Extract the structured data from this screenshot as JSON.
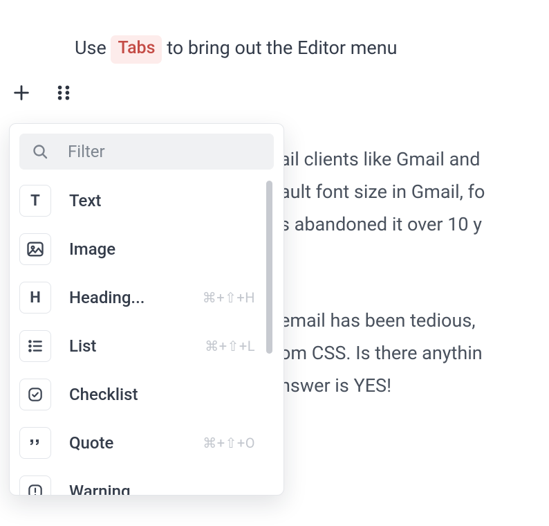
{
  "top_instruction": {
    "prefix": "Use",
    "badge": "Tabs",
    "suffix": "to bring out the Editor menu"
  },
  "popup": {
    "filter_placeholder": "Filter",
    "items": [
      {
        "icon": "T",
        "type": "letter",
        "label": "Text",
        "shortcut": ""
      },
      {
        "icon": "image",
        "type": "svg",
        "label": "Image",
        "shortcut": ""
      },
      {
        "icon": "H",
        "type": "letter",
        "label": "Heading...",
        "shortcut": "⌘+⇧+H"
      },
      {
        "icon": "list",
        "type": "svg",
        "label": "List",
        "shortcut": "⌘+⇧+L"
      },
      {
        "icon": "checklist",
        "type": "svg",
        "label": "Checklist",
        "shortcut": ""
      },
      {
        "icon": "quote",
        "type": "svg",
        "label": "Quote",
        "shortcut": "⌘+⇧+O"
      },
      {
        "icon": "warning",
        "type": "svg",
        "label": "Warning",
        "shortcut": ""
      }
    ]
  },
  "background_lines": [
    "ail clients like Gmail and",
    "ault font size in Gmail, fo",
    "s abandoned it over 10 y",
    "",
    "email has been tedious,",
    "om CSS. Is there anythin",
    "nswer is YES!"
  ]
}
